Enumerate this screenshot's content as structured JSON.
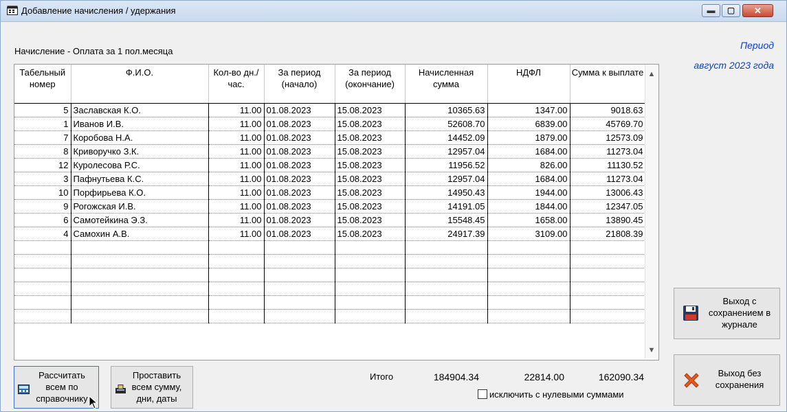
{
  "window": {
    "title": "Добавление начисления / удержания"
  },
  "operation_label": "Начисление - Оплата за 1 пол.месяца",
  "period": {
    "label": "Период",
    "value": "август 2023 года"
  },
  "table": {
    "headers": [
      "Табельный номер",
      "Ф.И.О.",
      "Кол-во дн./час.",
      "За период (начало)",
      "За период (окончание)",
      "Начисленная сумма",
      "НДФЛ",
      "Сумма к выплате"
    ],
    "rows": [
      {
        "tab": "5",
        "fio": "Заславская К.О.",
        "qty": "11.00",
        "start": "01.08.2023",
        "end": "15.08.2023",
        "accrued": "10365.63",
        "ndfl": "1347.00",
        "pay": "9018.63"
      },
      {
        "tab": "1",
        "fio": "Иванов И.В.",
        "qty": "11.00",
        "start": "01.08.2023",
        "end": "15.08.2023",
        "accrued": "52608.70",
        "ndfl": "6839.00",
        "pay": "45769.70"
      },
      {
        "tab": "7",
        "fio": "Коробова Н.А.",
        "qty": "11.00",
        "start": "01.08.2023",
        "end": "15.08.2023",
        "accrued": "14452.09",
        "ndfl": "1879.00",
        "pay": "12573.09"
      },
      {
        "tab": "8",
        "fio": "Криворучко З.К.",
        "qty": "11.00",
        "start": "01.08.2023",
        "end": "15.08.2023",
        "accrued": "12957.04",
        "ndfl": "1684.00",
        "pay": "11273.04"
      },
      {
        "tab": "12",
        "fio": "Куролесова Р.С.",
        "qty": "11.00",
        "start": "01.08.2023",
        "end": "15.08.2023",
        "accrued": "11956.52",
        "ndfl": "826.00",
        "pay": "11130.52"
      },
      {
        "tab": "3",
        "fio": "Пафнутьева К.С.",
        "qty": "11.00",
        "start": "01.08.2023",
        "end": "15.08.2023",
        "accrued": "12957.04",
        "ndfl": "1684.00",
        "pay": "11273.04"
      },
      {
        "tab": "10",
        "fio": "Порфирьева К.О.",
        "qty": "11.00",
        "start": "01.08.2023",
        "end": "15.08.2023",
        "accrued": "14950.43",
        "ndfl": "1944.00",
        "pay": "13006.43"
      },
      {
        "tab": "9",
        "fio": "Рогожская И.В.",
        "qty": "11.00",
        "start": "01.08.2023",
        "end": "15.08.2023",
        "accrued": "14191.05",
        "ndfl": "1844.00",
        "pay": "12347.05"
      },
      {
        "tab": "6",
        "fio": "Самотейкина Э.З.",
        "qty": "11.00",
        "start": "01.08.2023",
        "end": "15.08.2023",
        "accrued": "15548.45",
        "ndfl": "1658.00",
        "pay": "13890.45"
      },
      {
        "tab": "4",
        "fio": "Самохин А.В.",
        "qty": "11.00",
        "start": "01.08.2023",
        "end": "15.08.2023",
        "accrued": "24917.39",
        "ndfl": "3109.00",
        "pay": "21808.39"
      }
    ]
  },
  "totals": {
    "label": "Итого",
    "accrued": "184904.34",
    "ndfl": "22814.00",
    "pay": "162090.34"
  },
  "exclude_zero_label": "исключить с нулевыми суммами",
  "buttons": {
    "calc": "Рассчитать всем по справочнику",
    "stamp": "Проставить всем сумму, дни, даты",
    "save": "Выход с сохранением в журнале",
    "nosave": "Выход без сохранения"
  },
  "colors": {
    "period_text": "#0b3fd2",
    "close_button": "#c74a36"
  }
}
